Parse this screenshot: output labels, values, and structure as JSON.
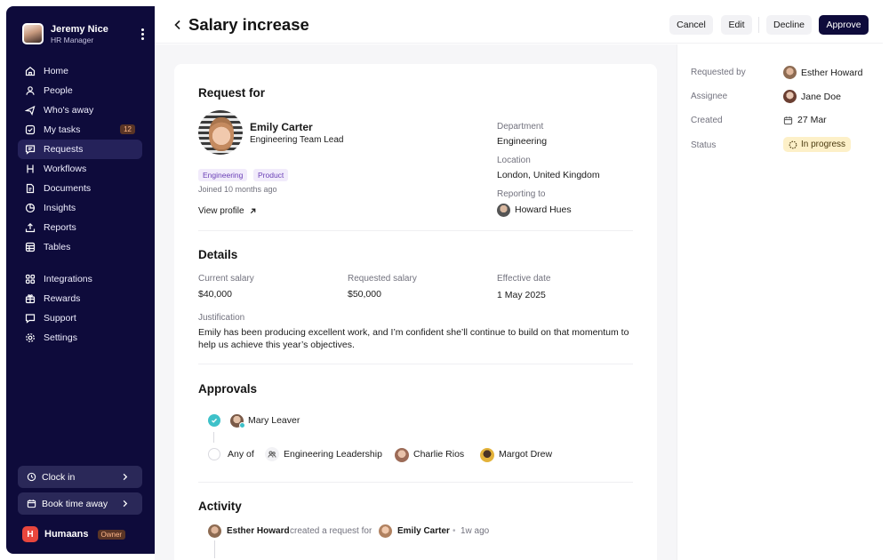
{
  "user": {
    "name": "Jeremy Nice",
    "role": "HR Manager"
  },
  "nav": [
    {
      "label": "Home",
      "icon": "home-icon"
    },
    {
      "label": "People",
      "icon": "person-icon"
    },
    {
      "label": "Who's away",
      "icon": "plane-icon"
    },
    {
      "label": "My tasks",
      "icon": "checkbox-icon",
      "badge": "12"
    },
    {
      "label": "Requests",
      "icon": "chat-icon",
      "active": true
    },
    {
      "label": "Workflows",
      "icon": "workflow-icon"
    },
    {
      "label": "Documents",
      "icon": "document-icon"
    },
    {
      "label": "Insights",
      "icon": "chart-icon"
    },
    {
      "label": "Reports",
      "icon": "upload-icon"
    },
    {
      "label": "Tables",
      "icon": "table-icon"
    }
  ],
  "nav2": [
    {
      "label": "Integrations",
      "icon": "grid-icon"
    },
    {
      "label": "Rewards",
      "icon": "gift-icon"
    },
    {
      "label": "Support",
      "icon": "help-icon"
    },
    {
      "label": "Settings",
      "icon": "gear-icon"
    }
  ],
  "sidebar_bottom": {
    "clock_in": "Clock in",
    "book_time": "Book time away",
    "brand_letter": "H",
    "brand": "Humaans",
    "owner": "Owner"
  },
  "header": {
    "title": "Salary increase",
    "cancel": "Cancel",
    "edit": "Edit",
    "decline": "Decline",
    "approve": "Approve"
  },
  "request_for": {
    "heading": "Request for",
    "name": "Emily Carter",
    "role": "Engineering Team Lead",
    "tags": [
      "Engineering",
      "Product"
    ],
    "joined": "Joined 10 months ago",
    "view_profile": "View profile",
    "department_label": "Department",
    "department": "Engineering",
    "location_label": "Location",
    "location": "London, United Kingdom",
    "reporting_label": "Reporting to",
    "reporting": "Howard Hues"
  },
  "details": {
    "heading": "Details",
    "current_label": "Current salary",
    "current": "$40,000",
    "requested_label": "Requested salary",
    "requested": "$50,000",
    "effective_label": "Effective date",
    "effective": "1 May 2025",
    "justification_label": "Justification",
    "justification": "Emily has been producing excellent work, and I’m confident she’ll continue to build on that momentum to help us achieve this year’s objectives."
  },
  "approvals": {
    "heading": "Approvals",
    "first": "Mary Leaver",
    "any_of": "Any of",
    "group": "Engineering Leadership",
    "p1": "Charlie Rios",
    "p2": "Margot Drew"
  },
  "activity": {
    "heading": "Activity",
    "actor": "Esther Howard",
    "action": "created a request for",
    "target": "Emily Carter",
    "time": "1w ago"
  },
  "panel": {
    "requested_by_label": "Requested by",
    "requested_by": "Esther Howard",
    "assignee_label": "Assignee",
    "assignee": "Jane Doe",
    "created_label": "Created",
    "created": "27 Mar",
    "status_label": "Status",
    "status": "In progress"
  },
  "colors": {
    "sidebar": "#0e0b3b",
    "accent": "#0e0b3b",
    "check": "#3ec1c9",
    "status_bg": "#fdf0c8",
    "tag_text": "#6a3fb6"
  }
}
